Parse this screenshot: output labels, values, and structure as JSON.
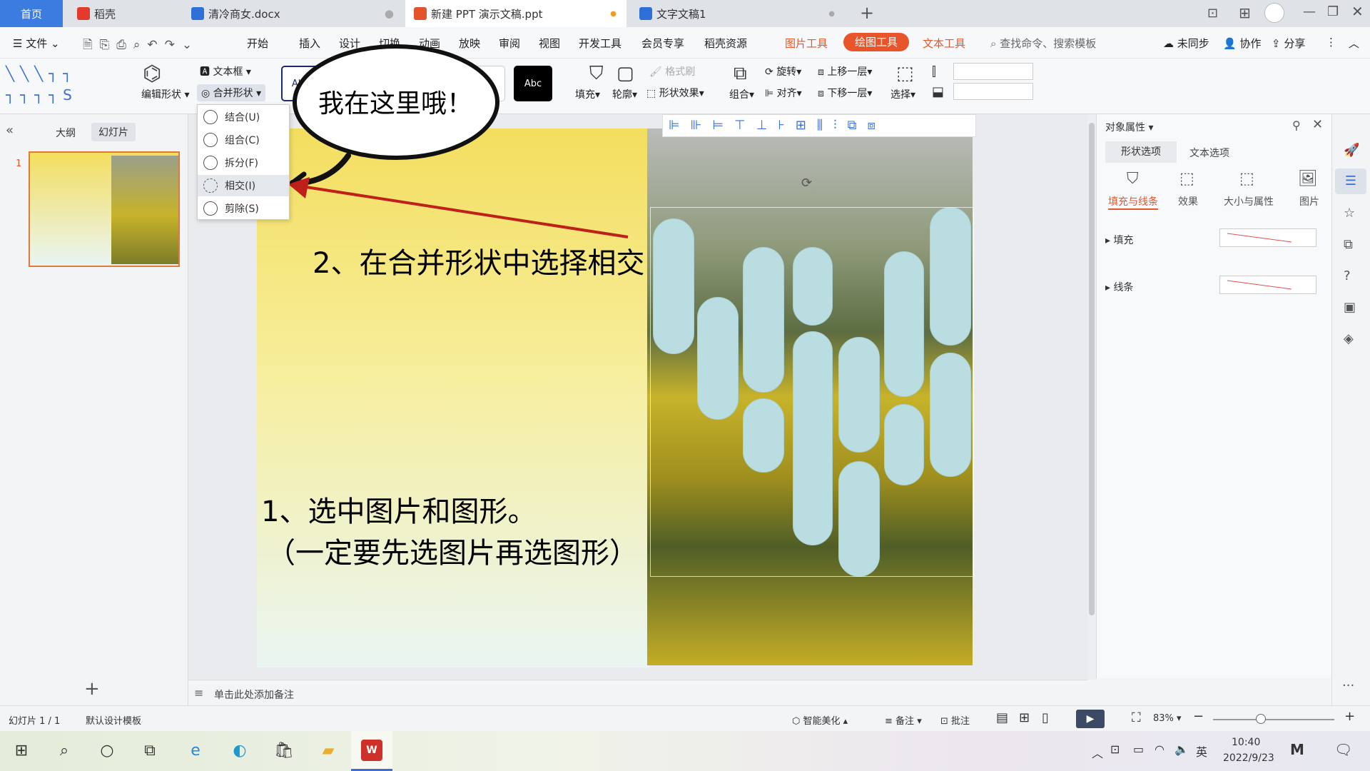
{
  "tabs": {
    "home": "首页",
    "daoke": "稻壳",
    "doc1": "清冷商女.docx",
    "ppt": "新建 PPT 演示文稿.ppt",
    "doc2": "文字文稿1"
  },
  "menubar": {
    "file": "文件",
    "items": [
      "开始",
      "插入",
      "设计",
      "切换",
      "动画",
      "放映",
      "审阅",
      "视图",
      "开发工具",
      "会员专享",
      "稻壳资源"
    ],
    "ctx_picture": "图片工具",
    "ctx_drawing": "绘图工具",
    "ctx_text": "文本工具",
    "search": "查找命令、搜索模板",
    "unsynced": "未同步",
    "collab": "协作",
    "share": "分享"
  },
  "ribbon": {
    "edit_shape": "编辑形状",
    "textbox": "文本框",
    "merge_shapes": "合并形状",
    "swatch_text": "Abc",
    "fill": "填充",
    "outline": "轮廓",
    "format_painter": "格式刷",
    "shape_effect": "形状效果",
    "group": "组合",
    "rotate": "旋转",
    "align": "对齐",
    "bring_forward": "上移一层",
    "send_backward": "下移一层",
    "select": "选择"
  },
  "merge_menu": {
    "items": [
      "结合(U)",
      "组合(C)",
      "拆分(F)",
      "相交(I)",
      "剪除(S)"
    ]
  },
  "leftpane": {
    "outline": "大纲",
    "slides": "幻灯片",
    "slide_num": "1"
  },
  "annotations": {
    "bubble": "我在这里哦！",
    "step2": "2、在合并形状中选择相交",
    "step1": "1、选中图片和图形。",
    "step1_note": "（一定要先选图片再选图形）"
  },
  "rightpane": {
    "title": "对象属性",
    "tab_shape": "形状选项",
    "tab_text": "文本选项",
    "sub_fill_line": "填充与线条",
    "sub_effect": "效果",
    "sub_size": "大小与属性",
    "sub_picture": "图片",
    "fill": "填充",
    "line": "线条"
  },
  "notes": {
    "placeholder": "单击此处添加备注"
  },
  "status": {
    "slide_count": "幻灯片 1 / 1",
    "template": "默认设计模板",
    "smart": "智能美化",
    "notes": "备注",
    "comment": "批注",
    "zoom": "83%"
  },
  "taskbar": {
    "ime": "英",
    "time": "10:40",
    "date": "2022/9/23"
  },
  "colors": {
    "accent_orange": "#e8552a",
    "wps_red": "#d0302a",
    "arrow_red": "#c0201a"
  }
}
